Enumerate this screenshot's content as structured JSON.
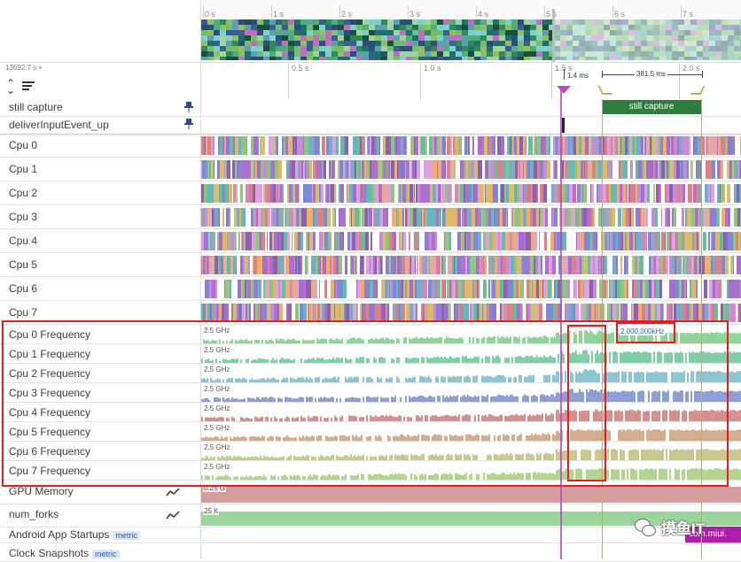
{
  "overview": {
    "ticks": [
      "0 s",
      "1 s",
      "2 s",
      "3 s",
      "4 s",
      "5 s",
      "6 s",
      "7 s"
    ]
  },
  "timeline": {
    "offset_label": "13692.7 s +",
    "ticks": [
      "0.5 s",
      "1.0 s",
      "1.5 s",
      "2.0 s"
    ],
    "span1": "1.4 ms",
    "span2": "381.5 ms"
  },
  "pinned": [
    {
      "label": "still capture"
    },
    {
      "label": "deliverInputEvent_up"
    }
  ],
  "slice": {
    "label": "still capture"
  },
  "cpus": [
    "Cpu 0",
    "Cpu 1",
    "Cpu 2",
    "Cpu 3",
    "Cpu 4",
    "Cpu 5",
    "Cpu 6",
    "Cpu 7"
  ],
  "freq_tracks": [
    {
      "label": "Cpu 0 Frequency",
      "scale": "2.5 GHz",
      "color": "#8fd49a"
    },
    {
      "label": "Cpu 1 Frequency",
      "scale": "2.5 GHz",
      "color": "#7fcfa9"
    },
    {
      "label": "Cpu 2 Frequency",
      "scale": "2.5 GHz",
      "color": "#8cc6d4"
    },
    {
      "label": "Cpu 3 Frequency",
      "scale": "2.5 GHz",
      "color": "#8f9fd4"
    },
    {
      "label": "Cpu 4 Frequency",
      "scale": "2.5 GHz",
      "color": "#d48f8f"
    },
    {
      "label": "Cpu 5 Frequency",
      "scale": "2.5 GHz",
      "color": "#d4ad8f"
    },
    {
      "label": "Cpu 6 Frequency",
      "scale": "2.5 GHz",
      "color": "#c9c98f"
    },
    {
      "label": "Cpu 7 Frequency",
      "scale": "2.5 GHz",
      "color": "#b3d48f"
    }
  ],
  "freq_tooltip": "2,000,000kHz",
  "counters": [
    {
      "label": "GPU Memory",
      "scale": "0.25 G",
      "color": "#d49c9c"
    },
    {
      "label": "num_forks",
      "scale": "25 K",
      "color": "#9cd49c"
    }
  ],
  "bottom_tracks": [
    {
      "label": "Android App Startups",
      "badge": "metric"
    },
    {
      "label": "Clock Snapshots",
      "badge": "metric"
    }
  ],
  "startup_slice": "com.miui.",
  "watermark": "摸鱼IT",
  "colors": {
    "highlight_box": "#e02020",
    "marker": "#b44fc0",
    "slice_green": "#2e7d3c",
    "flag": "#b8b06a"
  }
}
